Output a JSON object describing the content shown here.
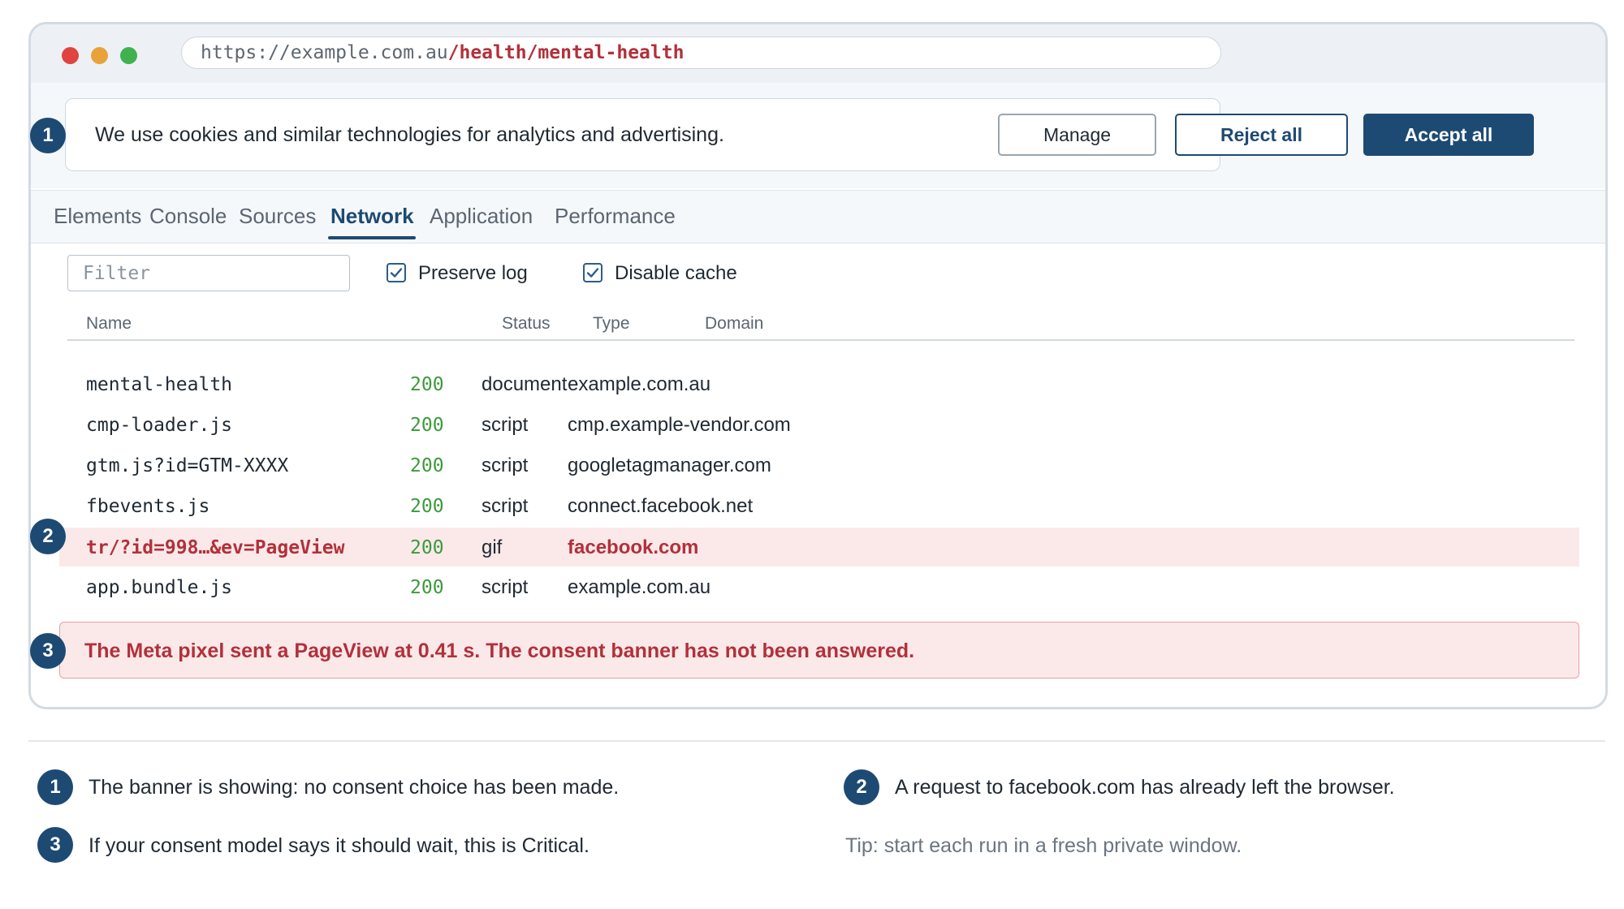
{
  "browser": {
    "url_base": "https://example.com.au",
    "url_path": "/health/mental-health"
  },
  "banner": {
    "text": "We use cookies and similar technologies for analytics and advertising.",
    "manage_label": "Manage",
    "reject_label": "Reject all",
    "accept_label": "Accept all"
  },
  "devtools": {
    "tabs": [
      "Elements",
      "Console",
      "Sources",
      "Network",
      "Application",
      "Performance"
    ],
    "active_tab": "Network",
    "filter_placeholder": "Filter",
    "preserve_log": {
      "label": "Preserve log",
      "checked": true
    },
    "disable_cache": {
      "label": "Disable cache",
      "checked": true
    },
    "columns": [
      "Name",
      "Status",
      "Type",
      "Domain"
    ],
    "requests": [
      {
        "name": "mental-health",
        "status": "200",
        "type": "document",
        "domain": "example.com.au",
        "flagged": false
      },
      {
        "name": "cmp-loader.js",
        "status": "200",
        "type": "script",
        "domain": "cmp.example-vendor.com",
        "flagged": false
      },
      {
        "name": "gtm.js?id=GTM-XXXX",
        "status": "200",
        "type": "script",
        "domain": "googletagmanager.com",
        "flagged": false
      },
      {
        "name": "fbevents.js",
        "status": "200",
        "type": "script",
        "domain": "connect.facebook.net",
        "flagged": false
      },
      {
        "name": "tr/?id=998…&ev=PageView",
        "status": "200",
        "type": "gif",
        "domain": "facebook.com",
        "flagged": true
      },
      {
        "name": "app.bundle.js",
        "status": "200",
        "type": "script",
        "domain": "example.com.au",
        "flagged": false
      }
    ],
    "alert": "The Meta pixel sent a PageView at 0.41 s. The consent banner has not been answered."
  },
  "markers": [
    "1",
    "2",
    "3"
  ],
  "notes": {
    "note1": "The banner is showing: no consent choice has been made.",
    "note2": "A request to facebook.com has already left the browser.",
    "note3": "If your consent model says it should wait, this is Critical.",
    "tip": "Tip: start each run in a fresh private window."
  },
  "colors": {
    "accent": "#1d4a73",
    "danger": "#b2303a",
    "danger_bg": "#fbe9ea",
    "status_ok": "#3c9a3c"
  }
}
